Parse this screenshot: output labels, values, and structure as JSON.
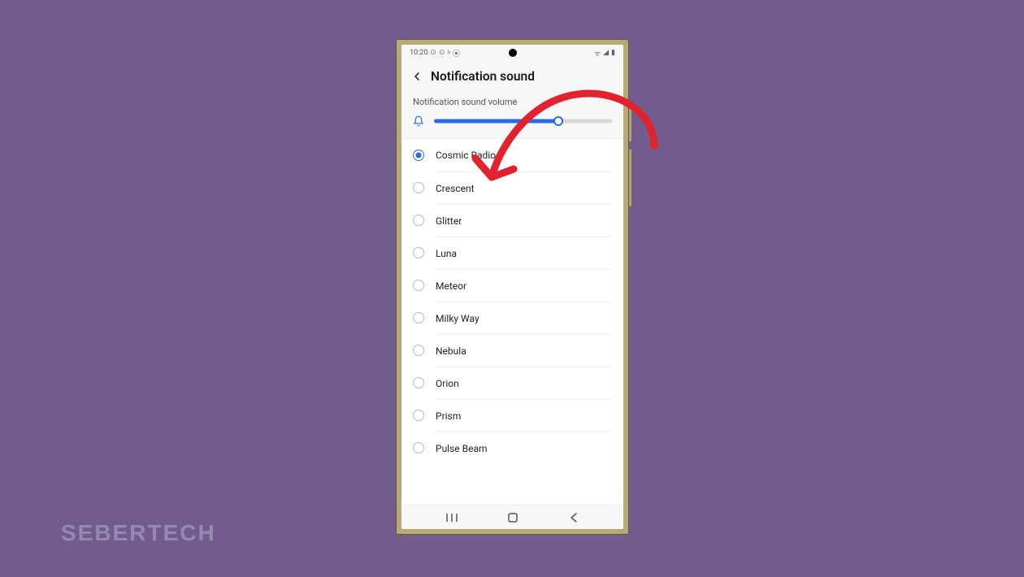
{
  "watermark": "SEBERTECH",
  "status": {
    "time": "10:20",
    "icons_left": [
      "⊙",
      "⊙",
      "ᵇ",
      "⦿"
    ],
    "icons_right": [
      "ᯤ",
      "◢",
      "▮"
    ]
  },
  "header": {
    "title": "Notification sound"
  },
  "volume": {
    "label": "Notification sound volume",
    "percent": 70
  },
  "sounds": [
    {
      "label": "Cosmic Radio",
      "selected": true
    },
    {
      "label": "Crescent",
      "selected": false
    },
    {
      "label": "Glitter",
      "selected": false
    },
    {
      "label": "Luna",
      "selected": false
    },
    {
      "label": "Meteor",
      "selected": false
    },
    {
      "label": "Milky Way",
      "selected": false
    },
    {
      "label": "Nebula",
      "selected": false
    },
    {
      "label": "Orion",
      "selected": false
    },
    {
      "label": "Prism",
      "selected": false
    },
    {
      "label": "Pulse Beam",
      "selected": false
    }
  ],
  "colors": {
    "accent": "#2a6be8",
    "annotation": "#e0232e",
    "background": "#725c8e"
  }
}
